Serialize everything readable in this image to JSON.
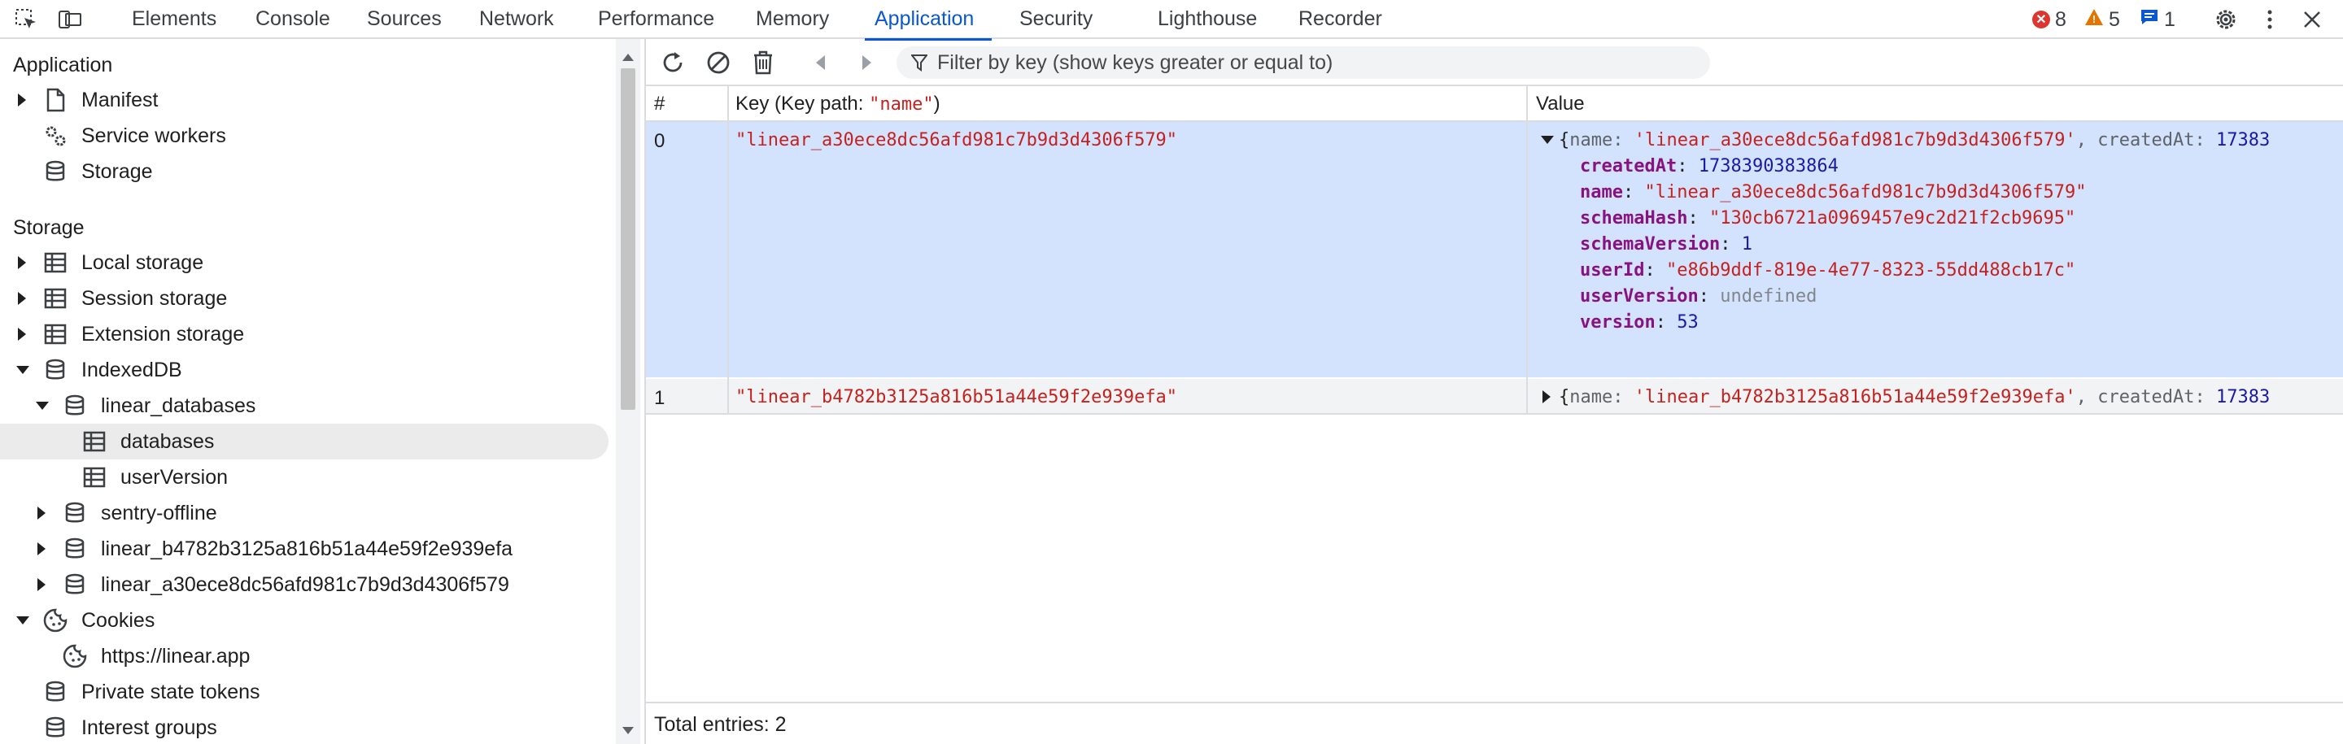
{
  "topbar": {
    "tabs": [
      "Elements",
      "Console",
      "Sources",
      "Network",
      "Performance",
      "Memory",
      "Application",
      "Security",
      "Lighthouse",
      "Recorder"
    ],
    "active_tab": "Application",
    "errors": "8",
    "warnings": "5",
    "messages": "1"
  },
  "sidebar": {
    "application_heading": "Application",
    "app_items": [
      "Manifest",
      "Service workers",
      "Storage"
    ],
    "storage_heading": "Storage",
    "storage_items": {
      "local": "Local storage",
      "session": "Session storage",
      "extension": "Extension storage",
      "indexeddb": "IndexedDB",
      "linear_databases": "linear_databases",
      "databases": "databases",
      "userVersion": "userVersion",
      "sentry": "sentry-offline",
      "db_b4782": "linear_b4782b3125a816b51a44e59f2e939efa",
      "db_a30ece": "linear_a30ece8dc56afd981c7b9d3d4306f579",
      "cookies": "Cookies",
      "cookie_origin": "https://linear.app",
      "private_state": "Private state tokens",
      "interest_groups": "Interest groups"
    }
  },
  "toolbar": {
    "filter_placeholder": "Filter by key (show keys greater or equal to)"
  },
  "table": {
    "col_num": "#",
    "col_key_prefix": "Key (Key path: ",
    "col_key_path": "\"name\"",
    "col_key_suffix": ")",
    "col_value": "Value",
    "rows": [
      {
        "index": "0",
        "key": "\"linear_a30ece8dc56afd981c7b9d3d4306f579\"",
        "summary_name_label": "name",
        "summary_name": "'linear_a30ece8dc56afd981c7b9d3d4306f579'",
        "summary_created_label": "createdAt",
        "summary_created": "17383",
        "props": {
          "createdAt": "1738390383864",
          "name": "\"linear_a30ece8dc56afd981c7b9d3d4306f579\"",
          "schemaHash": "\"130cb6721a0969457e9c2d21f2cb9695\"",
          "schemaVersion": "1",
          "userId": "\"e86b9ddf-819e-4e77-8323-55dd488cb17c\"",
          "userVersion": "undefined",
          "version": "53"
        }
      },
      {
        "index": "1",
        "key": "\"linear_b4782b3125a816b51a44e59f2e939efa\"",
        "summary_name_label": "name",
        "summary_name": "'linear_b4782b3125a816b51a44e59f2e939efa'",
        "summary_created_label": "createdAt",
        "summary_created": "17383"
      }
    ]
  },
  "footer": {
    "total_entries": "Total entries: 2"
  },
  "colors": {
    "accent": "#0b57d0",
    "selected_row": "#d3e3fd",
    "string": "#c5221f",
    "property": "#881280",
    "number": "#1a1aa6"
  }
}
